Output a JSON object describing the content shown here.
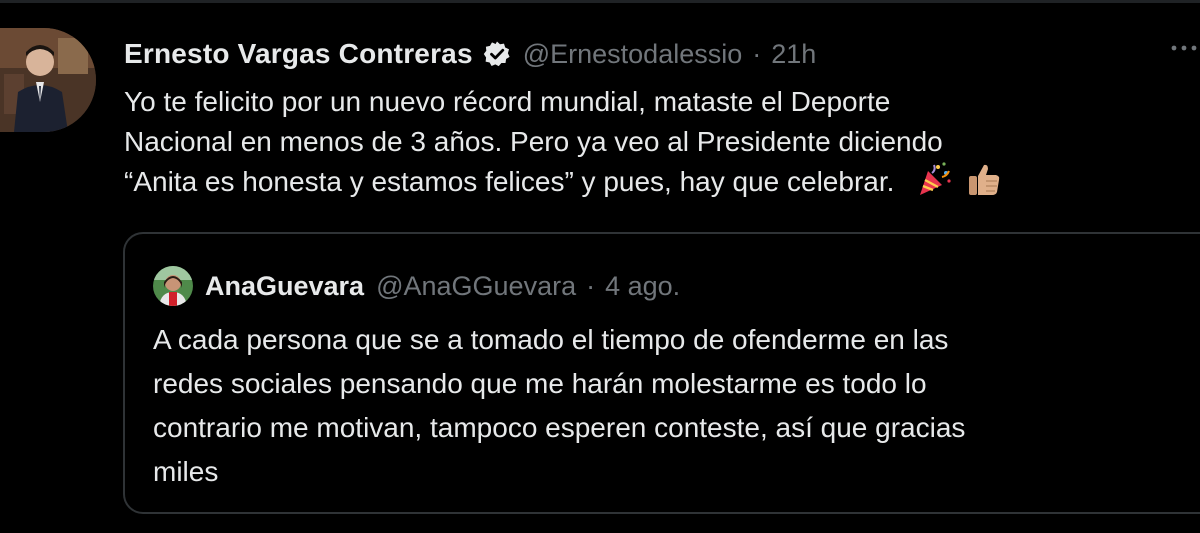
{
  "tweet": {
    "author": {
      "display_name": "Ernesto Vargas Contreras",
      "handle": "@Ernestodalessio",
      "verified": true
    },
    "separator": "·",
    "time": "21h",
    "text_line_1": "Yo te felicito por un nuevo récord mundial, mataste el Deporte",
    "text_line_2": "Nacional en menos de 3 años. Pero ya veo al Presidente diciendo",
    "text_line_3": "“Anita es honesta y estamos felices” y pues, hay que celebrar.",
    "emojis": [
      "party-popper-icon",
      "thumbs-up-icon"
    ],
    "more_icon": "more-horizontal-icon"
  },
  "quoted_tweet": {
    "author": {
      "display_name": "AnaGuevara",
      "handle": "@AnaGGuevara"
    },
    "separator": "·",
    "time": "4 ago.",
    "text_line_1": "A cada persona que se a tomado el tiempo de ofenderme en las",
    "text_line_2": "redes sociales pensando que me harán molestarme es todo lo",
    "text_line_3": "contrario me motivan, tampoco esperen conteste, así que gracias",
    "text_line_4": "miles"
  },
  "colors": {
    "background": "#000000",
    "primary_text": "#e7e9ea",
    "secondary_text": "#71767b",
    "border": "#2f3336"
  }
}
